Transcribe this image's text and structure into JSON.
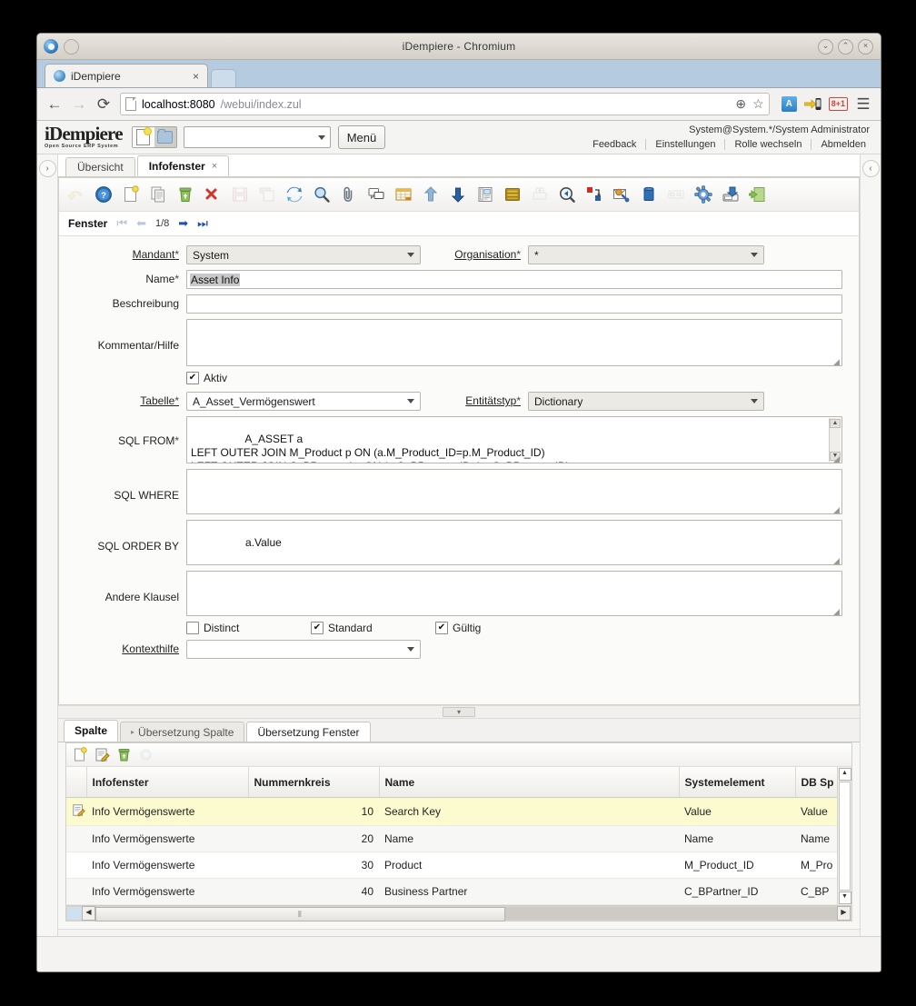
{
  "window": {
    "title": "iDempiere - Chromium",
    "minimize_label": "⌄",
    "maximize_label": "⌃",
    "close_label": "×"
  },
  "browser": {
    "tab": {
      "title": "iDempiere",
      "close_label": "×",
      "favicon": "idempiere-favicon"
    },
    "new_tab_label": "",
    "back_label": "←",
    "forward_label": "→",
    "reload_label": "⟳",
    "url_host": "localhost:8080",
    "url_path": "/webui/index.zul",
    "zoom_label": "⊕",
    "bookmark_label": "☆",
    "translate_badge": "A",
    "gplus_badge": "8+1",
    "menu_label": "☰"
  },
  "app_header": {
    "logo_main": "iDempiere",
    "logo_sub": "Open Source  ERP System",
    "search_value": "",
    "menu_button": "Menü",
    "user_line": "System@System.*/System Administrator",
    "links": [
      "Feedback",
      "Einstellungen",
      "Rolle wechseln",
      "Abmelden"
    ]
  },
  "rails": {
    "left_label": "›",
    "right_label": "‹"
  },
  "window_tabs": [
    {
      "label": "Übersicht",
      "selected": false,
      "closable": false
    },
    {
      "label": "Infofenster",
      "selected": true,
      "closable": true,
      "close_label": "×"
    }
  ],
  "toolbar": {
    "icons": [
      "undo-icon",
      "help-icon",
      "new-record-icon",
      "copy-record-icon",
      "delete-record-icon",
      "delete-selection-icon",
      "save-icon",
      "save-create-icon",
      "refresh-icon",
      "find-icon",
      "attachment-icon",
      "chat-icon",
      "grid-toggle-icon",
      "parent-record-icon",
      "detail-record-icon",
      "report-icon",
      "archive-icon",
      "print-icon",
      "zoom-across-icon",
      "active-workflow-icon",
      "request-icon",
      "product-info-icon",
      "export-icon",
      "preference-icon",
      "archive-document-icon",
      "exit-icon"
    ]
  },
  "record_nav": {
    "label": "Fenster",
    "first_label": "⏮",
    "prev_label": "⬅",
    "position": "1/8",
    "next_label": "➡",
    "last_label": "⏭"
  },
  "form": {
    "mandant": {
      "label": "Mandant",
      "required": "*",
      "value": "System"
    },
    "organisation": {
      "label": "Organisation",
      "required": "*",
      "value": "*"
    },
    "name": {
      "label": "Name",
      "required": "*",
      "value": "Asset Info"
    },
    "beschreibung": {
      "label": "Beschreibung",
      "value": ""
    },
    "kommentar": {
      "label": "Kommentar/Hilfe",
      "value": ""
    },
    "aktiv": {
      "label": "Aktiv",
      "checked": true,
      "check_glyph": "✔"
    },
    "tabelle": {
      "label": "Tabelle",
      "required": "*",
      "value": "A_Asset_Vermögenswert"
    },
    "entitaetstyp": {
      "label": "Entitätstyp",
      "required": "*",
      "value": "Dictionary"
    },
    "sql_from": {
      "label": "SQL FROM",
      "required": "*",
      "value": "A_ASSET a\nLEFT OUTER JOIN M_Product p ON (a.M_Product_ID=p.M_Product_ID)\nLEFT OUTER JOIN C_BPartner bp ON (a.C_BPartner_ID=bp.C_BPartner_ID)"
    },
    "sql_where": {
      "label": "SQL WHERE",
      "value": ""
    },
    "sql_order_by": {
      "label": "SQL ORDER BY",
      "value": "a.Value"
    },
    "andere_klausel": {
      "label": "Andere Klausel",
      "value": ""
    },
    "distinct": {
      "label": "Distinct",
      "checked": false,
      "check_glyph": ""
    },
    "standard": {
      "label": "Standard",
      "checked": true,
      "check_glyph": "✔"
    },
    "gueltig": {
      "label": "Gültig",
      "checked": true,
      "check_glyph": "✔"
    },
    "kontexthilfe": {
      "label": "Kontexthilfe",
      "value": ""
    }
  },
  "splitter": {
    "handle_label": "▾"
  },
  "bottom_tabs": [
    {
      "label": "Spalte",
      "selected": true,
      "style": "sel"
    },
    {
      "label": "Übersetzung Spalte",
      "selected": false,
      "style": "disabled",
      "marker": "▸"
    },
    {
      "label": "Übersetzung Fenster",
      "selected": false,
      "style": "plain"
    }
  ],
  "grid_toolbar": {
    "icons": [
      "new-row-icon",
      "edit-row-icon",
      "delete-row-icon",
      "process-icon"
    ]
  },
  "grid": {
    "columns": [
      "Infofenster",
      "Nummernkreis",
      "Name",
      "Systemelement",
      "DB Sp"
    ],
    "rows": [
      {
        "row_icon": "edit-row-icon",
        "cells": [
          "Info Vermögenswerte",
          "10",
          "Search Key",
          "Value",
          "Value"
        ],
        "selected": true
      },
      {
        "row_icon": "",
        "cells": [
          "Info Vermögenswerte",
          "20",
          "Name",
          "Name",
          "Name"
        ],
        "selected": false
      },
      {
        "row_icon": "",
        "cells": [
          "Info Vermögenswerte",
          "30",
          "Product",
          "M_Product_ID",
          "M_Pro"
        ],
        "selected": false
      },
      {
        "row_icon": "",
        "cells": [
          "Info Vermögenswerte",
          "40",
          "Business Partner",
          "C_BPartner_ID",
          "C_BP"
        ],
        "selected": false
      }
    ],
    "vscroll": {
      "up_label": "▲",
      "down_label": "▼"
    },
    "hscroll": {
      "left_label": "◀",
      "right_label": "▶",
      "grip_label": "⫴"
    }
  }
}
